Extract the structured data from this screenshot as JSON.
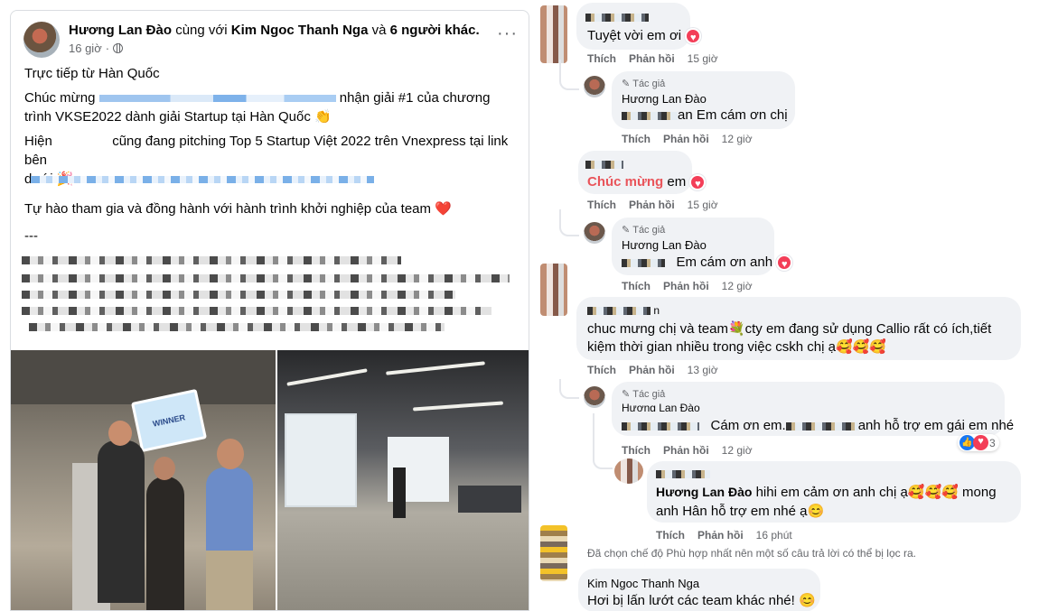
{
  "post": {
    "author": "Hương Lan Đào",
    "with_text": "cùng với",
    "tagged": "Kim Ngoc Thanh Nga",
    "and_text": "và",
    "others": "6 người khác.",
    "time": "16 giờ",
    "more_icon": "more-horizontal-icon",
    "privacy_icon": "globe-icon",
    "line1": "Trực tiếp từ Hàn Quốc",
    "line2a": "Chúc mừng",
    "line2b": "nhận giải #1 của chương",
    "line2c": "trình VKSE2022 dành giải Startup tại Hàn Quốc 👏",
    "line3a": "Hiện",
    "line3b": "cũng đang pitching Top 5 Startup Việt 2022 trên Vnexpress tại link bên",
    "line3c": "dưới 🎉",
    "line4": "Tự hào tham gia và đồng hành với hành trình khởi nghiệp của team ❤️",
    "separator": "---",
    "photo1_sign": "WINNER"
  },
  "comments": [
    {
      "text": "Tuyệt vời em ơi",
      "reaction": "heart",
      "like": "Thích",
      "reply": "Phản hồi",
      "time": "15 giờ"
    },
    {
      "badge": "Tác giả",
      "name": "Hương Lan Đào",
      "text": "an Em cám ơn chị",
      "like": "Thích",
      "reply": "Phản hồi",
      "time": "12 giờ"
    },
    {
      "text_highlight": "Chúc mừng",
      "text": "em",
      "reaction": "heart",
      "like": "Thích",
      "reply": "Phản hồi",
      "time": "15 giờ"
    },
    {
      "badge": "Tác giả",
      "name": "Hương Lan Đào",
      "text": "Em cám ơn anh",
      "reaction": "heart",
      "like": "Thích",
      "reply": "Phản hồi",
      "time": "12 giờ"
    },
    {
      "name_tail": "n",
      "text1": "chuc mưng chị và team💐cty em đang sử dụng Callio rất có ích,tiết",
      "text2": "kiệm thời gian nhiều trong việc cskh chị ạ🥰🥰🥰",
      "like": "Thích",
      "reply": "Phản hồi",
      "time": "13 giờ"
    },
    {
      "badge": "Tác giả",
      "name": "Hương Lan Đào",
      "text_a": "Cám ơn em.",
      "text_b": "anh hỗ trợ em gái em nhé",
      "reactions_count": "3",
      "like": "Thích",
      "reply": "Phản hồi",
      "time": "12 giờ"
    },
    {
      "name": "Hương Lan Đào",
      "text1": "hihi em cảm ơn anh chị ạ🥰🥰🥰 mong",
      "text2": "anh Hân hỗ trợ em nhé ạ😊",
      "like": "Thích",
      "reply": "Phản hồi",
      "time": "16 phút"
    }
  ],
  "filter_notice": "Đã chọn chế độ Phù hợp nhất nên một số câu trả lời có thể bị lọc ra.",
  "last_comment": {
    "name": "Kim Ngoc Thanh Nga",
    "text": "Hơi bị lấn lướt các team khác nhé! 😊"
  }
}
